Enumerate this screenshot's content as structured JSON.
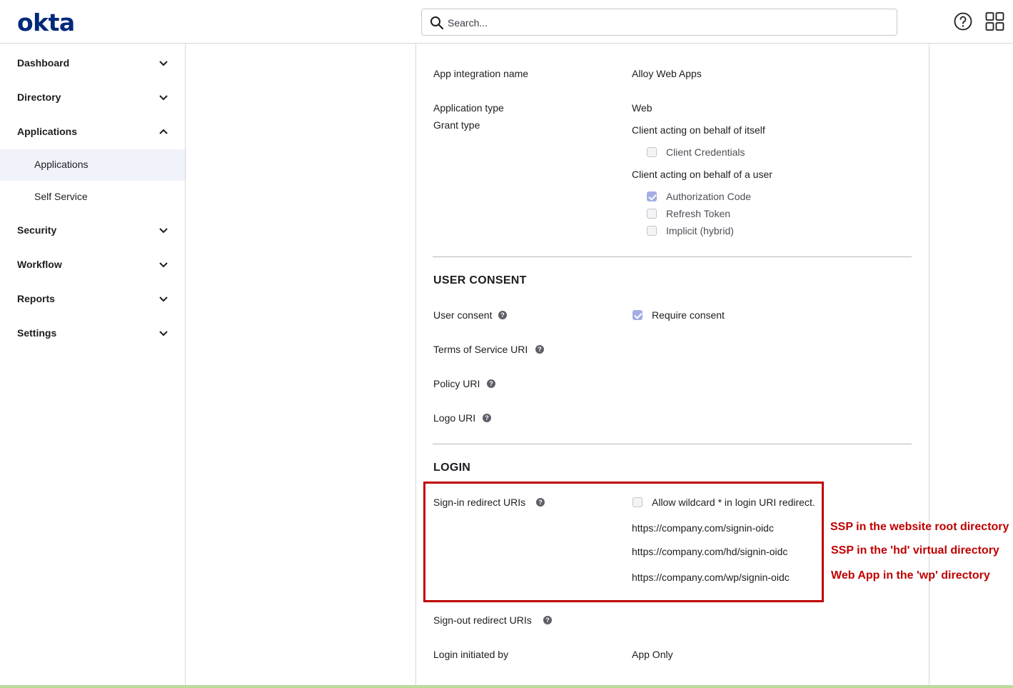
{
  "header": {
    "logo": "okta",
    "search_placeholder": "Search...",
    "help_icon": "help-circle-icon",
    "apps_icon": "grid-icon"
  },
  "sidebar": {
    "items": [
      {
        "label": "Dashboard",
        "icon": "chevron-down-icon"
      },
      {
        "label": "Directory",
        "icon": "chevron-down-icon"
      },
      {
        "label": "Applications",
        "icon": "chevron-up-icon",
        "children": [
          {
            "label": "Applications",
            "active": true
          },
          {
            "label": "Self Service",
            "active": false
          }
        ]
      },
      {
        "label": "Security",
        "icon": "chevron-down-icon"
      },
      {
        "label": "Workflow",
        "icon": "chevron-down-icon"
      },
      {
        "label": "Reports",
        "icon": "chevron-down-icon"
      },
      {
        "label": "Settings",
        "icon": "chevron-down-icon"
      }
    ]
  },
  "general": {
    "app_name_label": "App integration name",
    "app_name_value": "Alloy Web Apps",
    "app_type_label": "Application type",
    "app_type_value": "Web",
    "grant_type_label": "Grant type",
    "itself_label": "Client acting on behalf of itself",
    "client_credentials": {
      "label": "Client Credentials",
      "checked": false
    },
    "user_label": "Client acting on behalf of a user",
    "authorization_code": {
      "label": "Authorization Code",
      "checked": true
    },
    "refresh_token": {
      "label": "Refresh Token",
      "checked": false
    },
    "implicit": {
      "label": "Implicit (hybrid)",
      "checked": false
    }
  },
  "user_consent": {
    "heading": "USER CONSENT",
    "consent_label": "User consent",
    "require_consent": {
      "label": "Require consent",
      "checked": true
    },
    "tos_label": "Terms of Service URI",
    "policy_label": "Policy URI",
    "logo_label": "Logo URI"
  },
  "login": {
    "heading": "LOGIN",
    "signin_label": "Sign-in redirect URIs",
    "wildcard": {
      "label": "Allow wildcard * in login URI redirect.",
      "checked": false
    },
    "uris": [
      "https://company.com/signin-oidc",
      "https://company.com/hd/signin-oidc",
      "https://company.com/wp/signin-oidc"
    ],
    "signout_label": "Sign-out redirect URIs",
    "initiated_label": "Login initiated by",
    "initiated_value": "App Only"
  },
  "annotations": [
    "SSP in the website root directory",
    "SSP in the 'hd' virtual directory",
    "Web App in the 'wp' directory"
  ],
  "colors": {
    "brand": "#00297a",
    "annotation": "#c00000",
    "active_nav_bg": "#f1f3fb",
    "checkbox_checked": "#a3ade4"
  }
}
